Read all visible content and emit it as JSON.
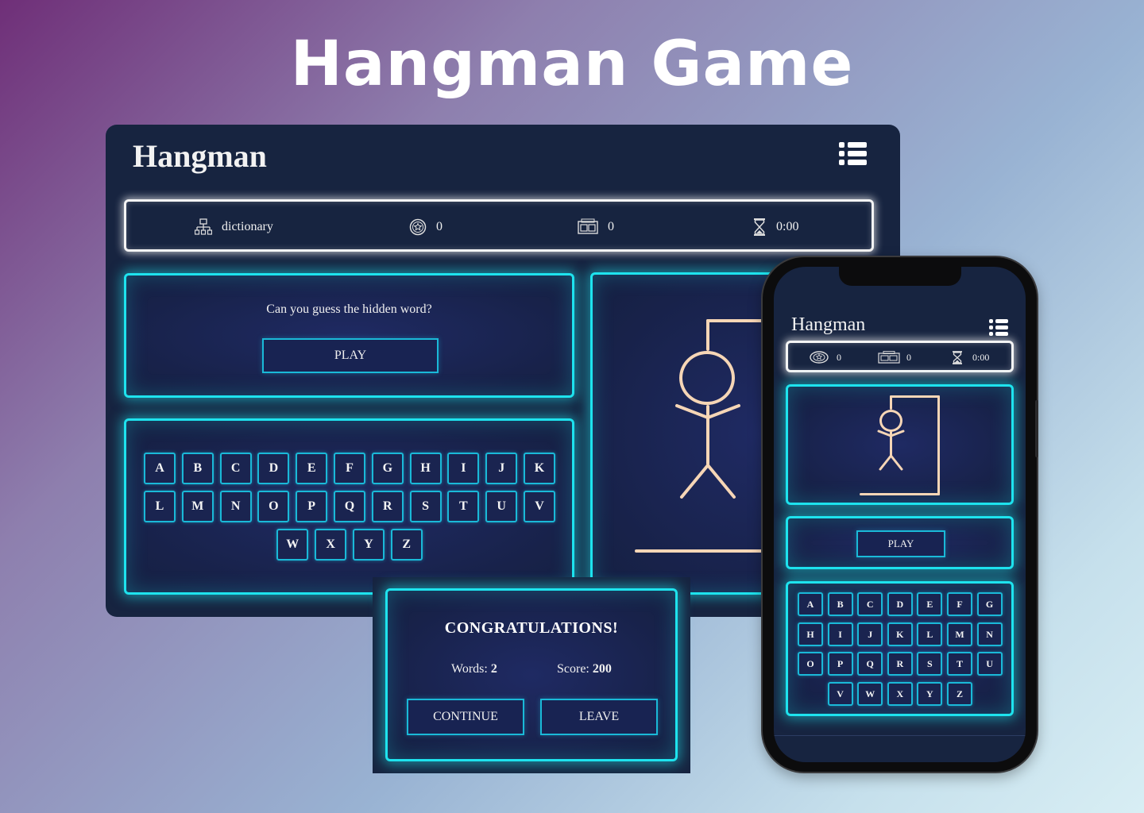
{
  "page": {
    "title": "Hangman Game"
  },
  "desktop": {
    "app_title": "Hangman",
    "menu_icon": "list-menu-icon",
    "status": {
      "category_icon": "hierarchy-icon",
      "category": "dictionary",
      "coins_icon": "star-coin-icon",
      "coins": "0",
      "score_icon": "scoreboard-icon",
      "score": "0",
      "timer_icon": "hourglass-icon",
      "time": "0:00"
    },
    "prompt": "Can you guess the hidden word?",
    "play_label": "PLAY",
    "keyboard_rows": [
      [
        "A",
        "B",
        "C",
        "D",
        "E",
        "F",
        "G",
        "H",
        "I",
        "J",
        "K"
      ],
      [
        "L",
        "M",
        "N",
        "O",
        "P",
        "Q",
        "R",
        "S",
        "T",
        "U",
        "V"
      ],
      [
        "W",
        "X",
        "Y",
        "Z"
      ]
    ]
  },
  "modal": {
    "title": "CONGRATULATIONS!",
    "words_label": "Words:",
    "words_value": "2",
    "score_label": "Score:",
    "score_value": "200",
    "continue_label": "CONTINUE",
    "leave_label": "LEAVE"
  },
  "mobile": {
    "app_title": "Hangman",
    "status": {
      "coins": "0",
      "score": "0",
      "time": "0:00"
    },
    "play_label": "PLAY",
    "keyboard_rows": [
      [
        "A",
        "B",
        "C",
        "D",
        "E",
        "F",
        "G"
      ],
      [
        "H",
        "I",
        "J",
        "K",
        "L",
        "M",
        "N"
      ],
      [
        "O",
        "P",
        "Q",
        "R",
        "S",
        "T",
        "U"
      ],
      [
        "V",
        "W",
        "X",
        "Y",
        "Z"
      ]
    ]
  },
  "colors": {
    "neon": "#1ee3ee",
    "panel": "#172440",
    "figure": "#f6d6b6"
  }
}
